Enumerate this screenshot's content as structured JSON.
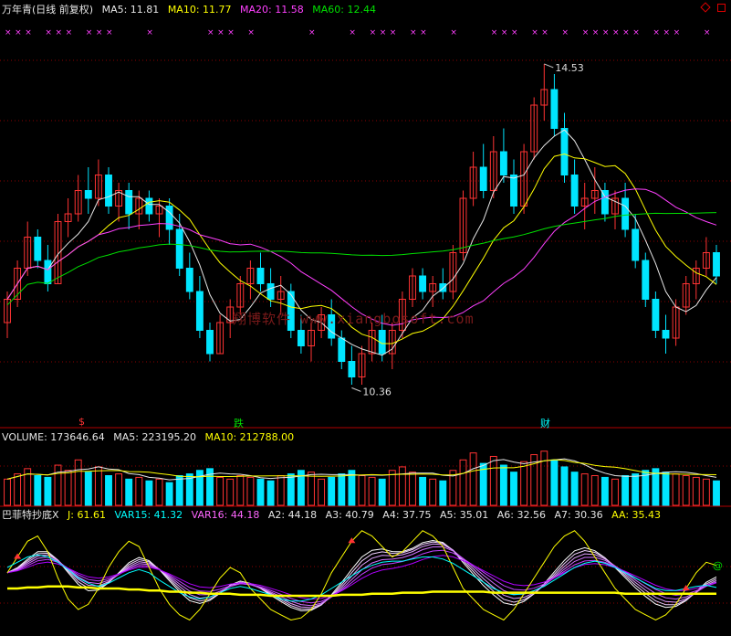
{
  "header": {
    "title": "万年青(日线 前复权)",
    "ma5": "MA5: 11.81",
    "ma10": "MA10: 11.77",
    "ma20": "MA20: 11.58",
    "ma60": "MA60: 12.44"
  },
  "volume_header": {
    "volume": "VOLUME: 173646.64",
    "ma5": "MA5: 223195.20",
    "ma10": "MA10: 212788.00"
  },
  "indicator_header": {
    "name": "巴菲特抄底X",
    "j": "J: 61.61",
    "var15": "VAR15: 41.32",
    "var16": "VAR16: 44.18",
    "a2": "A2: 44.18",
    "a3": "A3: 40.79",
    "a4": "A4: 37.75",
    "a5": "A5: 35.01",
    "a6": "A6: 32.56",
    "a7": "A7: 30.36",
    "aa": "AA: 35.43"
  },
  "annotations": {
    "high": "14.53",
    "low": "10.36"
  },
  "events": {
    "e1": "$",
    "e2": "跌",
    "e3": "财"
  },
  "watermark": "翔博软件 www.xiangbosoft.com",
  "indicator_marks": {
    "signal": "@"
  },
  "colors": {
    "up": "#ff3333",
    "down": "#00e5ff",
    "ma5": "#e6e6e6",
    "ma10": "#ffff00",
    "ma20": "#ff40ff",
    "ma60": "#00e000",
    "grid": "#8b0000"
  },
  "chart_data": [
    {
      "type": "candlestick",
      "title": "万年青(日线 前复权)",
      "ylim": [
        10.0,
        15.0
      ],
      "annotations": [
        {
          "label": "14.53",
          "value": 14.53
        },
        {
          "label": "10.36",
          "value": 10.36
        }
      ],
      "ohlc": [
        [
          11.2,
          11.6,
          11.0,
          11.5
        ],
        [
          11.5,
          12.0,
          11.4,
          11.9
        ],
        [
          11.9,
          12.5,
          11.8,
          12.3
        ],
        [
          12.3,
          12.4,
          11.9,
          12.0
        ],
        [
          12.0,
          12.2,
          11.6,
          11.7
        ],
        [
          11.7,
          12.6,
          11.7,
          12.5
        ],
        [
          12.5,
          12.8,
          12.3,
          12.6
        ],
        [
          12.6,
          13.1,
          12.5,
          12.9
        ],
        [
          12.9,
          13.2,
          12.6,
          12.8
        ],
        [
          12.8,
          13.3,
          12.7,
          13.1
        ],
        [
          13.1,
          13.2,
          12.6,
          12.7
        ],
        [
          12.7,
          13.0,
          12.5,
          12.9
        ],
        [
          12.9,
          13.0,
          12.4,
          12.6
        ],
        [
          12.6,
          12.9,
          12.4,
          12.8
        ],
        [
          12.8,
          12.9,
          12.5,
          12.6
        ],
        [
          12.6,
          12.8,
          12.3,
          12.7
        ],
        [
          12.7,
          12.8,
          12.2,
          12.4
        ],
        [
          12.4,
          12.6,
          11.8,
          11.9
        ],
        [
          11.9,
          12.1,
          11.5,
          11.6
        ],
        [
          11.6,
          11.8,
          11.0,
          11.1
        ],
        [
          11.1,
          11.2,
          10.7,
          10.8
        ],
        [
          10.8,
          11.3,
          10.8,
          11.2
        ],
        [
          11.2,
          11.5,
          11.0,
          11.4
        ],
        [
          11.4,
          11.8,
          11.3,
          11.7
        ],
        [
          11.7,
          12.0,
          11.5,
          11.9
        ],
        [
          11.9,
          12.1,
          11.6,
          11.7
        ],
        [
          11.7,
          11.9,
          11.4,
          11.5
        ],
        [
          11.5,
          11.8,
          11.3,
          11.6
        ],
        [
          11.6,
          11.7,
          11.0,
          11.1
        ],
        [
          11.1,
          11.3,
          10.8,
          10.9
        ],
        [
          10.9,
          11.2,
          10.7,
          11.1
        ],
        [
          11.1,
          11.4,
          11.0,
          11.3
        ],
        [
          11.3,
          11.5,
          10.9,
          11.0
        ],
        [
          11.0,
          11.1,
          10.6,
          10.7
        ],
        [
          10.7,
          10.9,
          10.4,
          10.5
        ],
        [
          10.5,
          10.9,
          10.4,
          10.8
        ],
        [
          10.8,
          11.2,
          10.7,
          11.1
        ],
        [
          11.1,
          11.3,
          10.7,
          10.8
        ],
        [
          10.8,
          11.2,
          10.6,
          11.1
        ],
        [
          11.1,
          11.6,
          11.0,
          11.5
        ],
        [
          11.5,
          11.9,
          11.4,
          11.8
        ],
        [
          11.8,
          11.9,
          11.5,
          11.6
        ],
        [
          11.6,
          11.8,
          11.4,
          11.7
        ],
        [
          11.7,
          11.9,
          11.5,
          11.6
        ],
        [
          11.6,
          12.2,
          11.5,
          12.1
        ],
        [
          12.1,
          12.9,
          12.0,
          12.8
        ],
        [
          12.8,
          13.4,
          12.7,
          13.2
        ],
        [
          13.2,
          13.5,
          12.8,
          12.9
        ],
        [
          12.9,
          13.6,
          12.8,
          13.4
        ],
        [
          13.4,
          13.7,
          13.0,
          13.1
        ],
        [
          13.1,
          13.3,
          12.6,
          12.7
        ],
        [
          12.7,
          13.5,
          12.6,
          13.4
        ],
        [
          13.4,
          14.1,
          13.3,
          14.0
        ],
        [
          14.0,
          14.53,
          13.8,
          14.2
        ],
        [
          14.2,
          14.4,
          13.6,
          13.7
        ],
        [
          13.7,
          13.9,
          13.0,
          13.1
        ],
        [
          13.1,
          13.3,
          12.6,
          12.7
        ],
        [
          12.7,
          13.0,
          12.4,
          12.8
        ],
        [
          12.8,
          13.2,
          12.6,
          12.9
        ],
        [
          12.9,
          13.0,
          12.5,
          12.6
        ],
        [
          12.6,
          12.9,
          12.4,
          12.8
        ],
        [
          12.8,
          13.0,
          12.3,
          12.4
        ],
        [
          12.4,
          12.6,
          11.9,
          12.0
        ],
        [
          12.0,
          12.1,
          11.4,
          11.5
        ],
        [
          11.5,
          11.6,
          11.0,
          11.1
        ],
        [
          11.1,
          11.3,
          10.8,
          11.0
        ],
        [
          11.0,
          11.5,
          10.9,
          11.4
        ],
        [
          11.4,
          11.8,
          11.3,
          11.7
        ],
        [
          11.7,
          12.0,
          11.5,
          11.9
        ],
        [
          11.9,
          12.3,
          11.8,
          12.1
        ],
        [
          12.1,
          12.2,
          11.7,
          11.8
        ]
      ]
    },
    {
      "type": "bar",
      "title": "VOLUME",
      "values": [
        150,
        180,
        210,
        170,
        160,
        230,
        200,
        260,
        190,
        220,
        170,
        180,
        150,
        160,
        140,
        150,
        130,
        170,
        180,
        200,
        210,
        160,
        150,
        170,
        160,
        150,
        140,
        170,
        180,
        200,
        190,
        150,
        160,
        180,
        200,
        170,
        160,
        150,
        200,
        220,
        190,
        160,
        150,
        140,
        200,
        260,
        300,
        240,
        280,
        230,
        190,
        250,
        290,
        310,
        260,
        220,
        190,
        180,
        170,
        160,
        150,
        170,
        180,
        200,
        210,
        190,
        180,
        170,
        160,
        150,
        140
      ],
      "ylim": [
        0,
        340
      ]
    },
    {
      "type": "line",
      "title": "巴菲特抄底X",
      "ylim": [
        0,
        100
      ],
      "series": [
        {
          "name": "J",
          "values": [
            55,
            70,
            85,
            90,
            75,
            50,
            30,
            20,
            25,
            40,
            60,
            75,
            85,
            80,
            60,
            40,
            25,
            15,
            10,
            20,
            35,
            50,
            60,
            55,
            40,
            30,
            20,
            15,
            10,
            12,
            20,
            35,
            55,
            70,
            85,
            95,
            90,
            80,
            70,
            75,
            85,
            95,
            90,
            80,
            60,
            40,
            30,
            20,
            15,
            10,
            20,
            35,
            50,
            65,
            80,
            90,
            95,
            85,
            70,
            55,
            40,
            30,
            20,
            15,
            10,
            15,
            25,
            40,
            55,
            65,
            62
          ]
        },
        {
          "name": "VAR15",
          "values": [
            60,
            65,
            70,
            72,
            70,
            65,
            58,
            50,
            45,
            42,
            45,
            50,
            55,
            58,
            55,
            48,
            42,
            36,
            32,
            30,
            32,
            36,
            40,
            42,
            40,
            37,
            34,
            30,
            28,
            28,
            30,
            34,
            40,
            46,
            52,
            58,
            62,
            65,
            66,
            66,
            68,
            70,
            70,
            68,
            64,
            58,
            52,
            46,
            40,
            36,
            34,
            35,
            38,
            42,
            48,
            54,
            60,
            64,
            66,
            64,
            60,
            55,
            50,
            45,
            40,
            38,
            38,
            40,
            42,
            43,
            41
          ]
        },
        {
          "name": "AA",
          "values": [
            40,
            40,
            41,
            41,
            42,
            42,
            42,
            41,
            41,
            40,
            40,
            40,
            39,
            39,
            38,
            38,
            37,
            37,
            36,
            36,
            35,
            35,
            35,
            34,
            34,
            34,
            33,
            33,
            33,
            33,
            33,
            33,
            33,
            34,
            34,
            34,
            35,
            35,
            35,
            36,
            36,
            36,
            37,
            37,
            37,
            37,
            37,
            37,
            36,
            36,
            36,
            36,
            36,
            36,
            36,
            36,
            36,
            36,
            36,
            36,
            36,
            35,
            35,
            35,
            35,
            35,
            35,
            35,
            35,
            35,
            35
          ]
        }
      ]
    }
  ]
}
